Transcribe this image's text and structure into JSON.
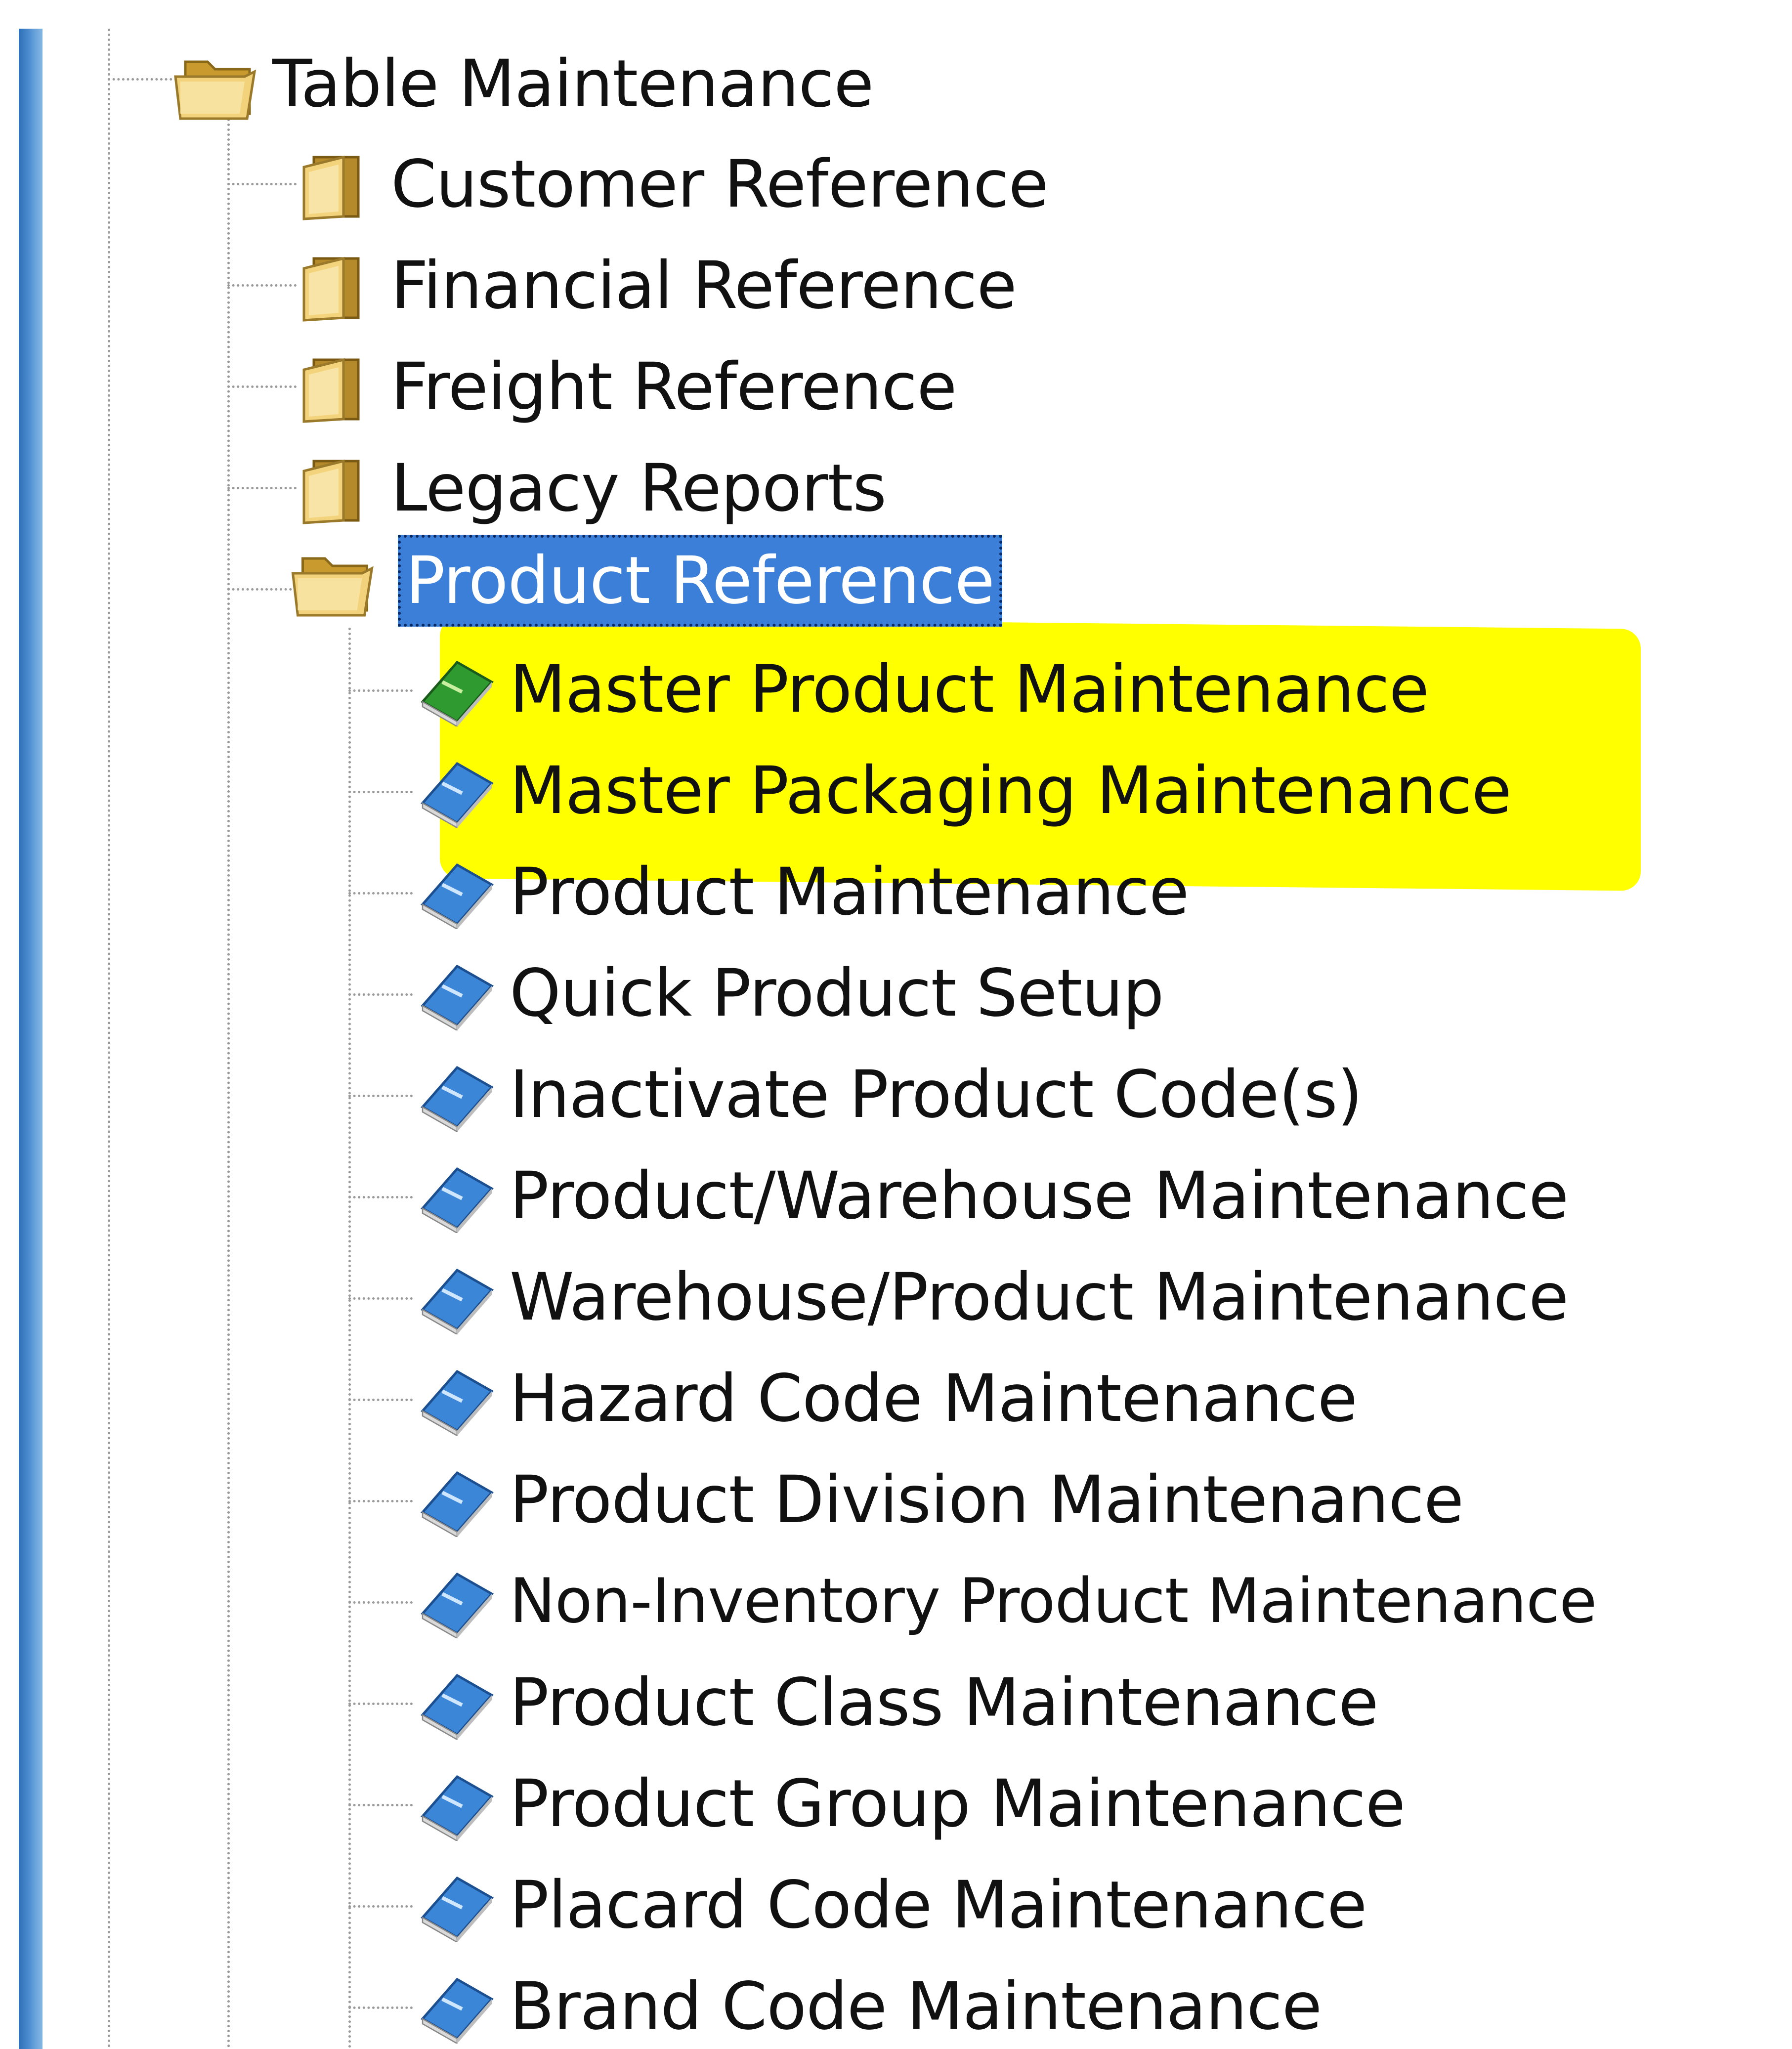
{
  "tree": {
    "root": {
      "label": "Table Maintenance",
      "icon": "folder-open-icon"
    },
    "folders": [
      {
        "label": "Customer Reference",
        "icon": "folder-icon"
      },
      {
        "label": "Financial Reference",
        "icon": "folder-icon"
      },
      {
        "label": "Freight Reference",
        "icon": "folder-icon"
      },
      {
        "label": "Legacy Reports",
        "icon": "folder-icon"
      },
      {
        "label": "Product Reference",
        "icon": "folder-open-icon",
        "selected": true
      }
    ],
    "items": [
      {
        "label": "Master Product Maintenance",
        "icon": "green-book-icon",
        "highlighted": true
      },
      {
        "label": "Master Packaging Maintenance",
        "icon": "book-icon",
        "highlighted": true
      },
      {
        "label": "Product Maintenance",
        "icon": "book-icon"
      },
      {
        "label": "Quick Product Setup",
        "icon": "book-icon"
      },
      {
        "label": "Inactivate Product Code(s)",
        "icon": "book-icon"
      },
      {
        "label": "Product/Warehouse Maintenance",
        "icon": "book-icon"
      },
      {
        "label": "Warehouse/Product Maintenance",
        "icon": "book-icon"
      },
      {
        "label": "Hazard Code Maintenance",
        "icon": "book-icon"
      },
      {
        "label": "Product Division Maintenance",
        "icon": "book-icon"
      },
      {
        "label": "Non-Inventory Product Maintenance",
        "icon": "book-icon"
      },
      {
        "label": "Product Class Maintenance",
        "icon": "book-icon"
      },
      {
        "label": "Product Group Maintenance",
        "icon": "book-icon"
      },
      {
        "label": "Placard Code Maintenance",
        "icon": "book-icon"
      },
      {
        "label": "Brand Code Maintenance",
        "icon": "book-icon"
      }
    ]
  },
  "colors": {
    "selection": "#3b7fd8",
    "highlight": "#ffff00",
    "border_accent": "#4f8ed0"
  }
}
